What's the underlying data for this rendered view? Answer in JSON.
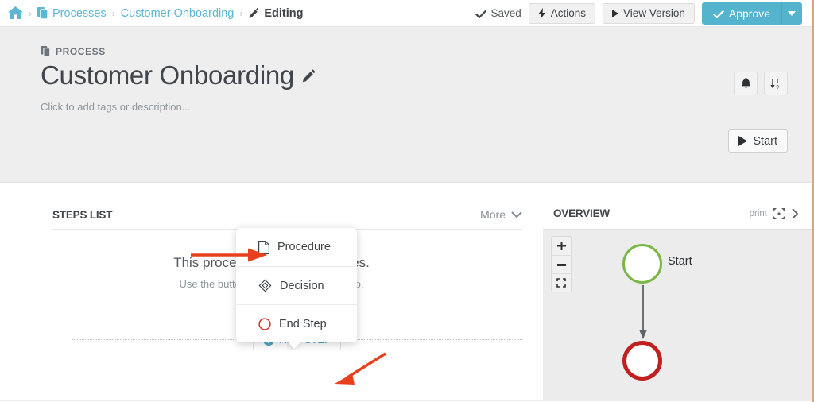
{
  "topbar": {
    "home_icon": "home-icon",
    "breadcrumbs": [
      {
        "label": "Processes",
        "icon": "copy-icon"
      },
      {
        "label": "Customer Onboarding",
        "icon": ""
      },
      {
        "label": "Editing",
        "icon": "pencil-icon"
      }
    ],
    "separator": "›",
    "saved_label": "Saved",
    "saved_icon": "check-icon",
    "actions_label": "Actions",
    "actions_icon": "bolt-icon",
    "view_version_label": "View Version",
    "view_version_icon": "play-icon",
    "approve_label": "Approve",
    "approve_icon": "check-icon",
    "approve_caret_icon": "caret-down-icon",
    "approve_color": "#54b4cd"
  },
  "process_header": {
    "kicker": "PROCESS",
    "kicker_icon": "copy-icon",
    "title": "Customer Onboarding",
    "title_edit_icon": "pencil-icon",
    "subtitle": "Click to add tags or description...",
    "bell_icon": "bell-icon",
    "sort_icon": "sort-numeric-icon",
    "start_label": "Start",
    "start_icon": "play-icon",
    "background_color": "#eeeeee"
  },
  "steps": {
    "title": "STEPS LIST",
    "more_label": "More",
    "more_icon": "chevron-down-icon",
    "empty_primary": "This process has no procedures.",
    "empty_secondary": "Use the button below to add a new step.",
    "add_step_label": "ADD STEP",
    "add_step_icon": "plus-circle-icon",
    "add_step_color": "#4fa8c7"
  },
  "step_type_menu": {
    "items": [
      {
        "label": "Procedure",
        "icon": "document-icon"
      },
      {
        "label": "Decision",
        "icon": "diamond-icon"
      },
      {
        "label": "End Step",
        "icon": "circle-red-icon"
      }
    ]
  },
  "overview": {
    "title": "OVERVIEW",
    "print_label": "print",
    "expand_icon": "expand-icon",
    "next_icon": "chevron-right-icon",
    "zoom_in_icon": "plus-icon",
    "zoom_out_icon": "minus-icon",
    "fit_icon": "fit-screen-icon",
    "nodes": [
      {
        "label": "Start",
        "type": "start",
        "color": "#7ab648"
      },
      {
        "label": "",
        "type": "end",
        "color": "#c0201f"
      }
    ]
  },
  "annotations": {
    "arrow_color": "#e8401c",
    "arrows": [
      {
        "target": "procedure-menu-item"
      },
      {
        "target": "add-step-button"
      }
    ]
  }
}
